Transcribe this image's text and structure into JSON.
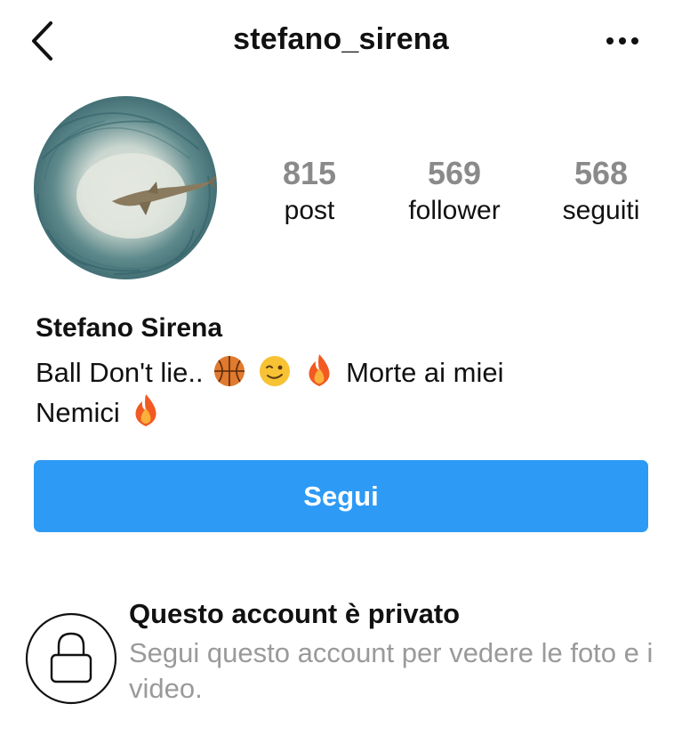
{
  "header": {
    "username": "stefano_sirena",
    "back_icon": "chevron-left-icon",
    "more_icon": "more-horizontal-icon"
  },
  "profile": {
    "avatar": "shark-among-fish-photo",
    "stats": [
      {
        "value": "815",
        "label": "post"
      },
      {
        "value": "569",
        "label": "follower"
      },
      {
        "value": "568",
        "label": "seguiti"
      }
    ],
    "display_name": "Stefano Sirena",
    "bio_line1_text": "Ball Don't lie..",
    "bio_line1_text2": "Morte ai miei",
    "bio_line2_text": "Nemici",
    "bio_emojis": [
      "basketball-icon",
      "winking-face-icon",
      "fire-icon",
      "fire-icon"
    ]
  },
  "actions": {
    "follow_label": "Segui",
    "follow_color": "#2d9af5"
  },
  "private_notice": {
    "icon": "lock-icon",
    "title": "Questo account è privato",
    "description": "Segui questo account per vedere le foto e i video."
  }
}
